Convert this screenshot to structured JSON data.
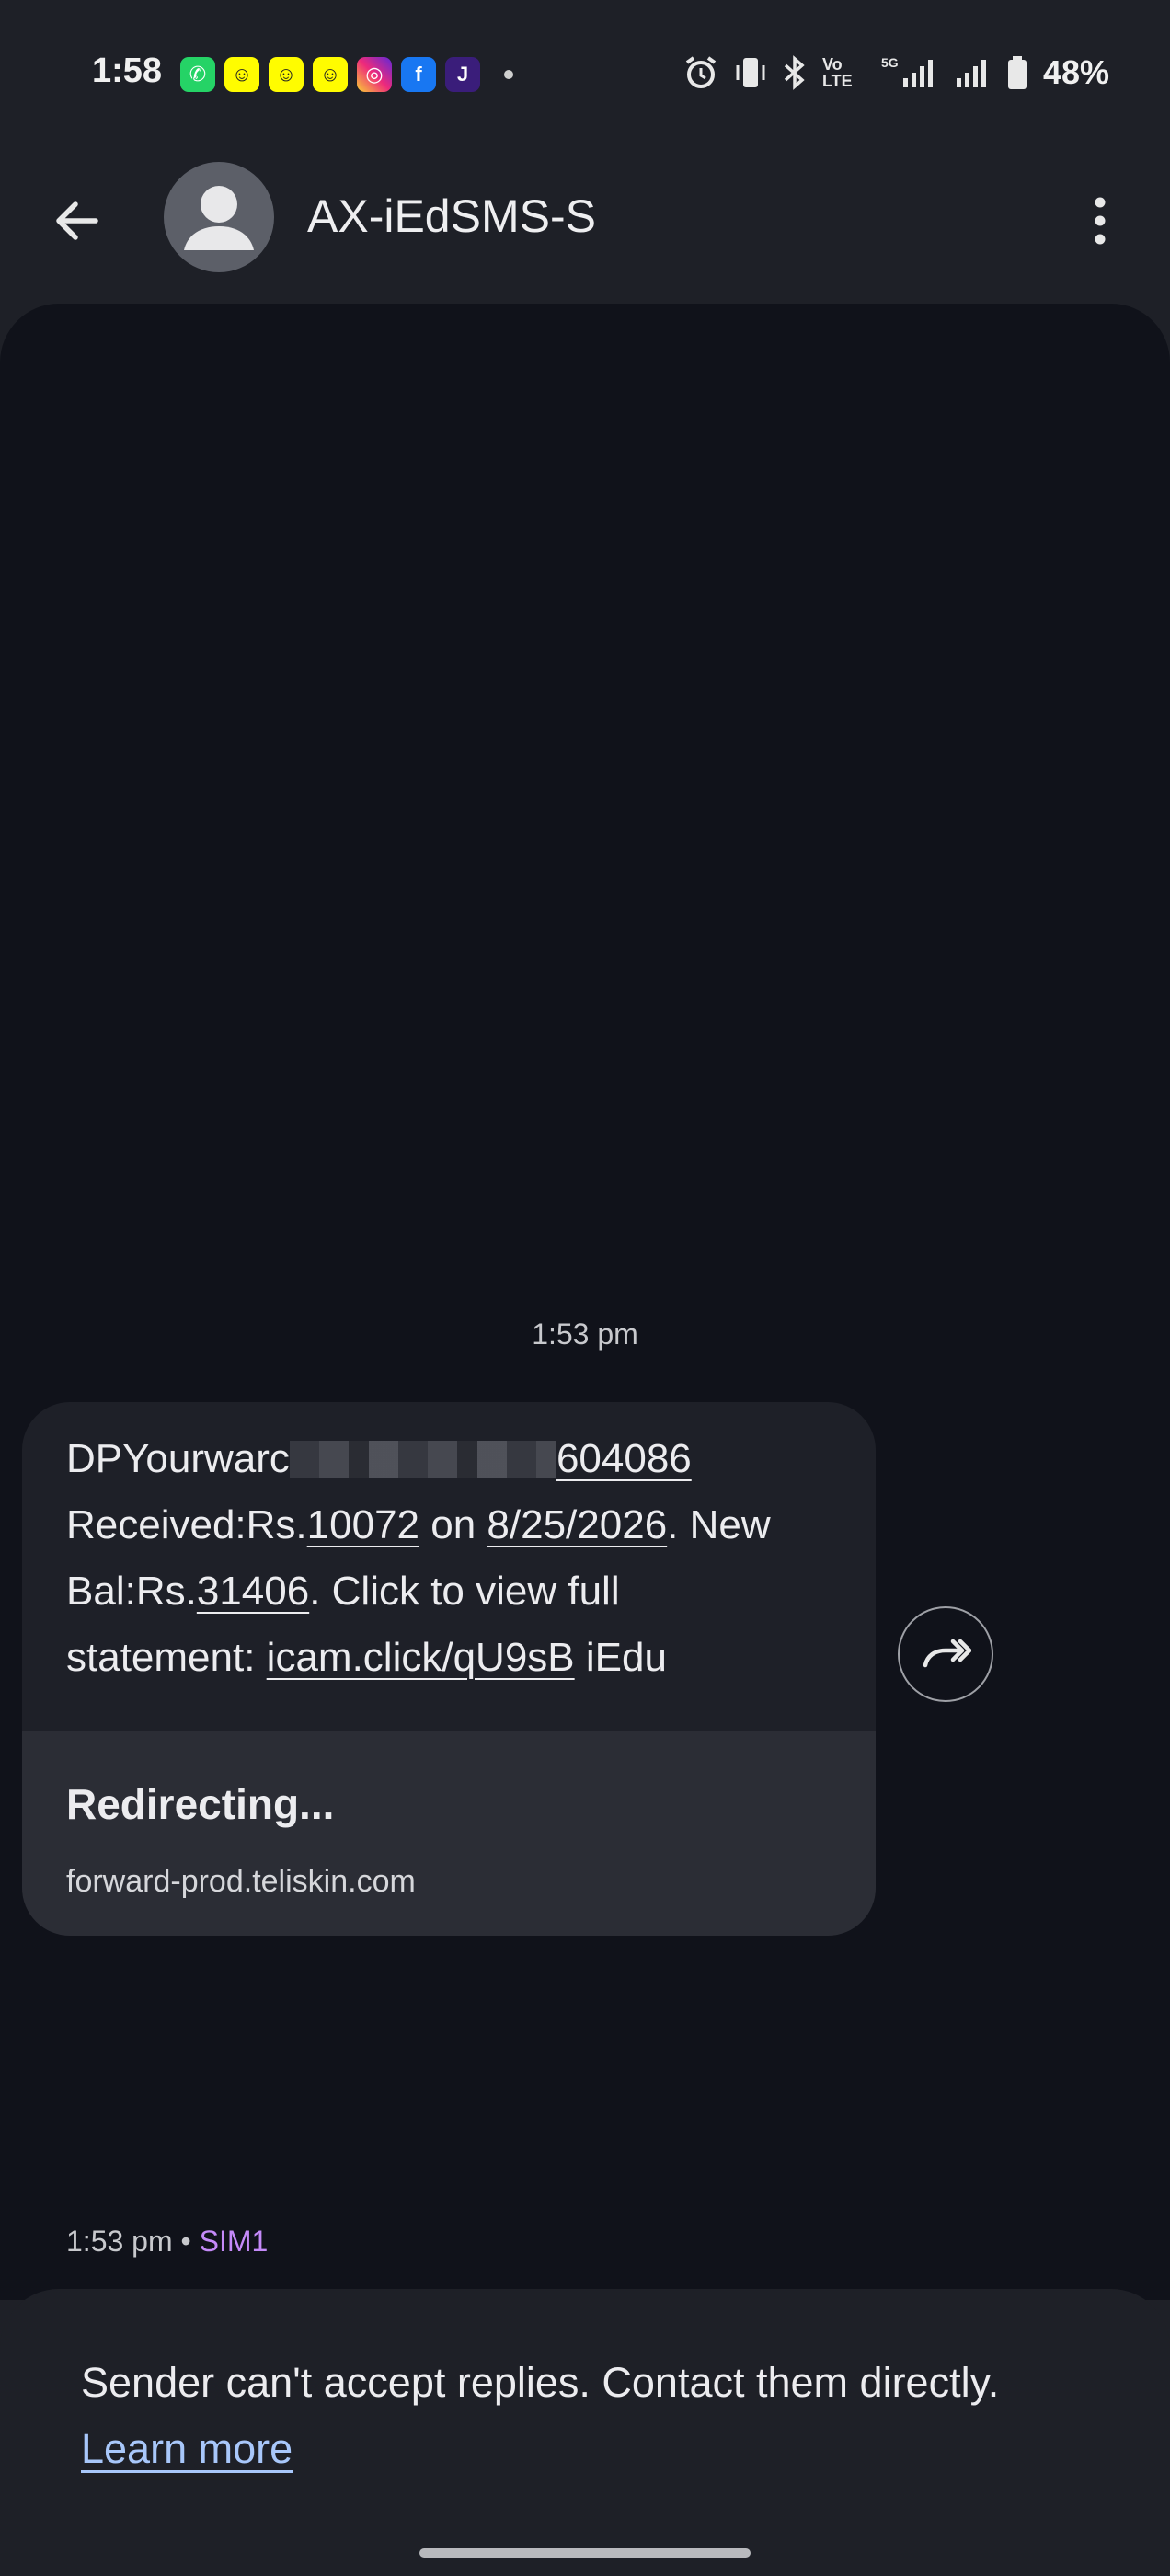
{
  "status_bar": {
    "time": "1:58",
    "app_icons": [
      {
        "name": "whatsapp-icon",
        "color": "#25d366",
        "glyph": "✆"
      },
      {
        "name": "snapchat-icon",
        "color": "#fffc00",
        "glyph": "☺"
      },
      {
        "name": "snapchat-icon",
        "color": "#fffc00",
        "glyph": "☺"
      },
      {
        "name": "snapchat-icon",
        "color": "#fffc00",
        "glyph": "☺"
      },
      {
        "name": "instagram-icon",
        "color": "#e1306c",
        "glyph": "◎"
      },
      {
        "name": "facebook-icon",
        "color": "#1877f2",
        "glyph": "f"
      },
      {
        "name": "jar-app-icon",
        "color": "#3a1d7a",
        "glyph": "J"
      }
    ],
    "battery_percent": "48%",
    "network_label": "5G",
    "volte_label": "Vo LTE"
  },
  "app_bar": {
    "contact_name": "AX-iEdSMS-S",
    "back_icon": "arrow-back-icon",
    "more_icon": "more-vert-icon"
  },
  "conversation": {
    "timestamp": "1:53 pm",
    "message": {
      "line1_prefix": "DPYourwarc",
      "line1_suffix": "604086",
      "received_label": "Received:Rs.",
      "amount": "10072",
      "on_label": " on ",
      "date": "8/25/2026",
      "new_label": ". New",
      "bal_label": "Bal:Rs.",
      "balance": "31406",
      "click_text": ". Click to view full",
      "statement_label": "statement: ",
      "link": "icam.click/qU9sB",
      "sender_sig": " iEdu"
    },
    "link_preview": {
      "title": "Redirecting...",
      "domain": "forward-prod.teliskin.com"
    },
    "meta_time": "1:53 pm",
    "meta_sep": " • ",
    "sim": "SIM1"
  },
  "notice": {
    "text": "Sender can't accept replies. Contact them directly.",
    "learn_more": "Learn more"
  }
}
